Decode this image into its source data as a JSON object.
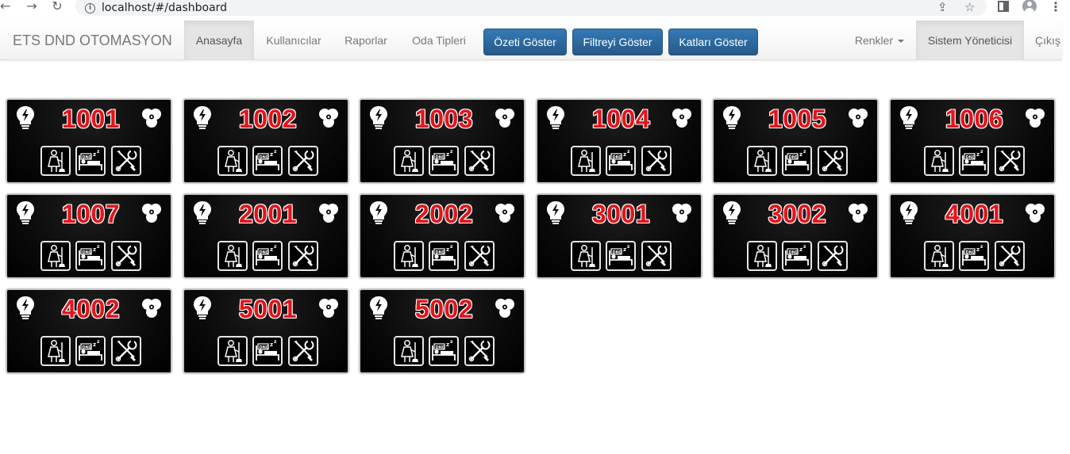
{
  "browser": {
    "url": "localhost/#/dashboard"
  },
  "navbar": {
    "brand": "ETS DND OTOMASYON",
    "items": [
      {
        "label": "Anasayfa",
        "active": true
      },
      {
        "label": "Kullanıcılar",
        "active": false
      },
      {
        "label": "Raporlar",
        "active": false
      },
      {
        "label": "Oda Tipleri",
        "active": false
      }
    ],
    "buttons": [
      {
        "label": "Özeti Göster"
      },
      {
        "label": "Filtreyi Göster"
      },
      {
        "label": "Katları Göster"
      }
    ],
    "colors_menu": "Renkler",
    "user": "Sistem Yöneticisi",
    "logout": "Çıkış"
  },
  "rooms": [
    {
      "number": "1001"
    },
    {
      "number": "1002"
    },
    {
      "number": "1003"
    },
    {
      "number": "1004"
    },
    {
      "number": "1005"
    },
    {
      "number": "1006"
    },
    {
      "number": "1007"
    },
    {
      "number": "2001"
    },
    {
      "number": "2002"
    },
    {
      "number": "3001"
    },
    {
      "number": "3002"
    },
    {
      "number": "4001"
    },
    {
      "number": "4002"
    },
    {
      "number": "5001"
    },
    {
      "number": "5002"
    }
  ],
  "colors": {
    "room_number": "#e3141b",
    "primary_button": "#286090",
    "card_background": "#000000"
  }
}
